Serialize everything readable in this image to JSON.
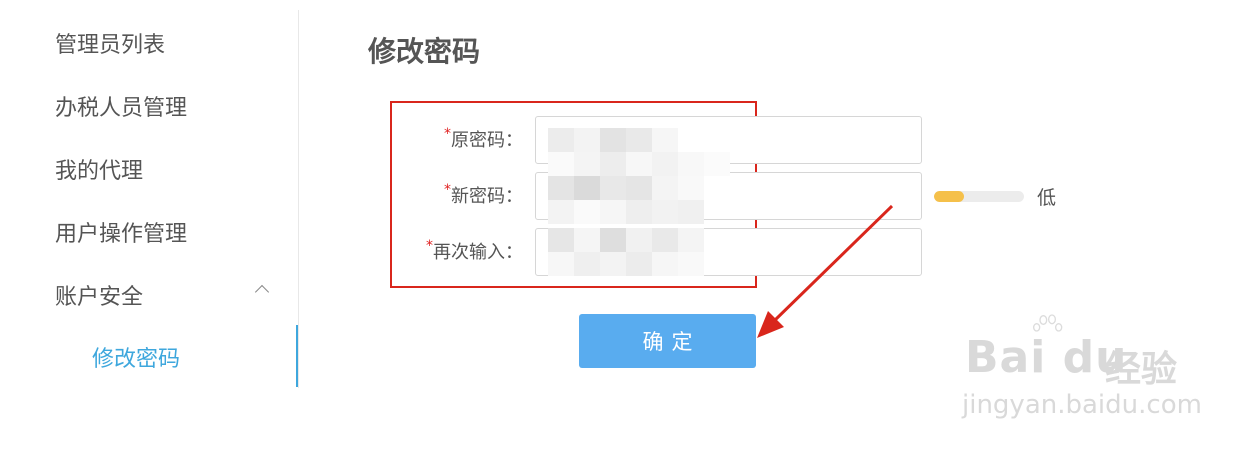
{
  "sidebar": {
    "items": [
      {
        "label": "管理员列表"
      },
      {
        "label": "办税人员管理"
      },
      {
        "label": "我的代理"
      },
      {
        "label": "用户操作管理"
      },
      {
        "label": "账户安全"
      }
    ],
    "sub_items": [
      {
        "label": "修改密码",
        "active": true
      }
    ]
  },
  "main": {
    "title": "修改密码",
    "form": {
      "required_mark": "*",
      "fields": [
        {
          "label": "原密码：",
          "value": ""
        },
        {
          "label": "新密码：",
          "value": ""
        },
        {
          "label": "再次输入：",
          "value": ""
        }
      ],
      "strength": {
        "level": 0.33,
        "label": "低"
      },
      "submit_label": "确定"
    }
  },
  "watermark": {
    "brand": "Bai du",
    "brand_cn": "经验",
    "url": "jingyan.baidu.com"
  },
  "colors": {
    "accent": "#3ea7dd",
    "button": "#59acef",
    "highlight": "#d9261c",
    "strength_fill": "#f5c04a"
  }
}
